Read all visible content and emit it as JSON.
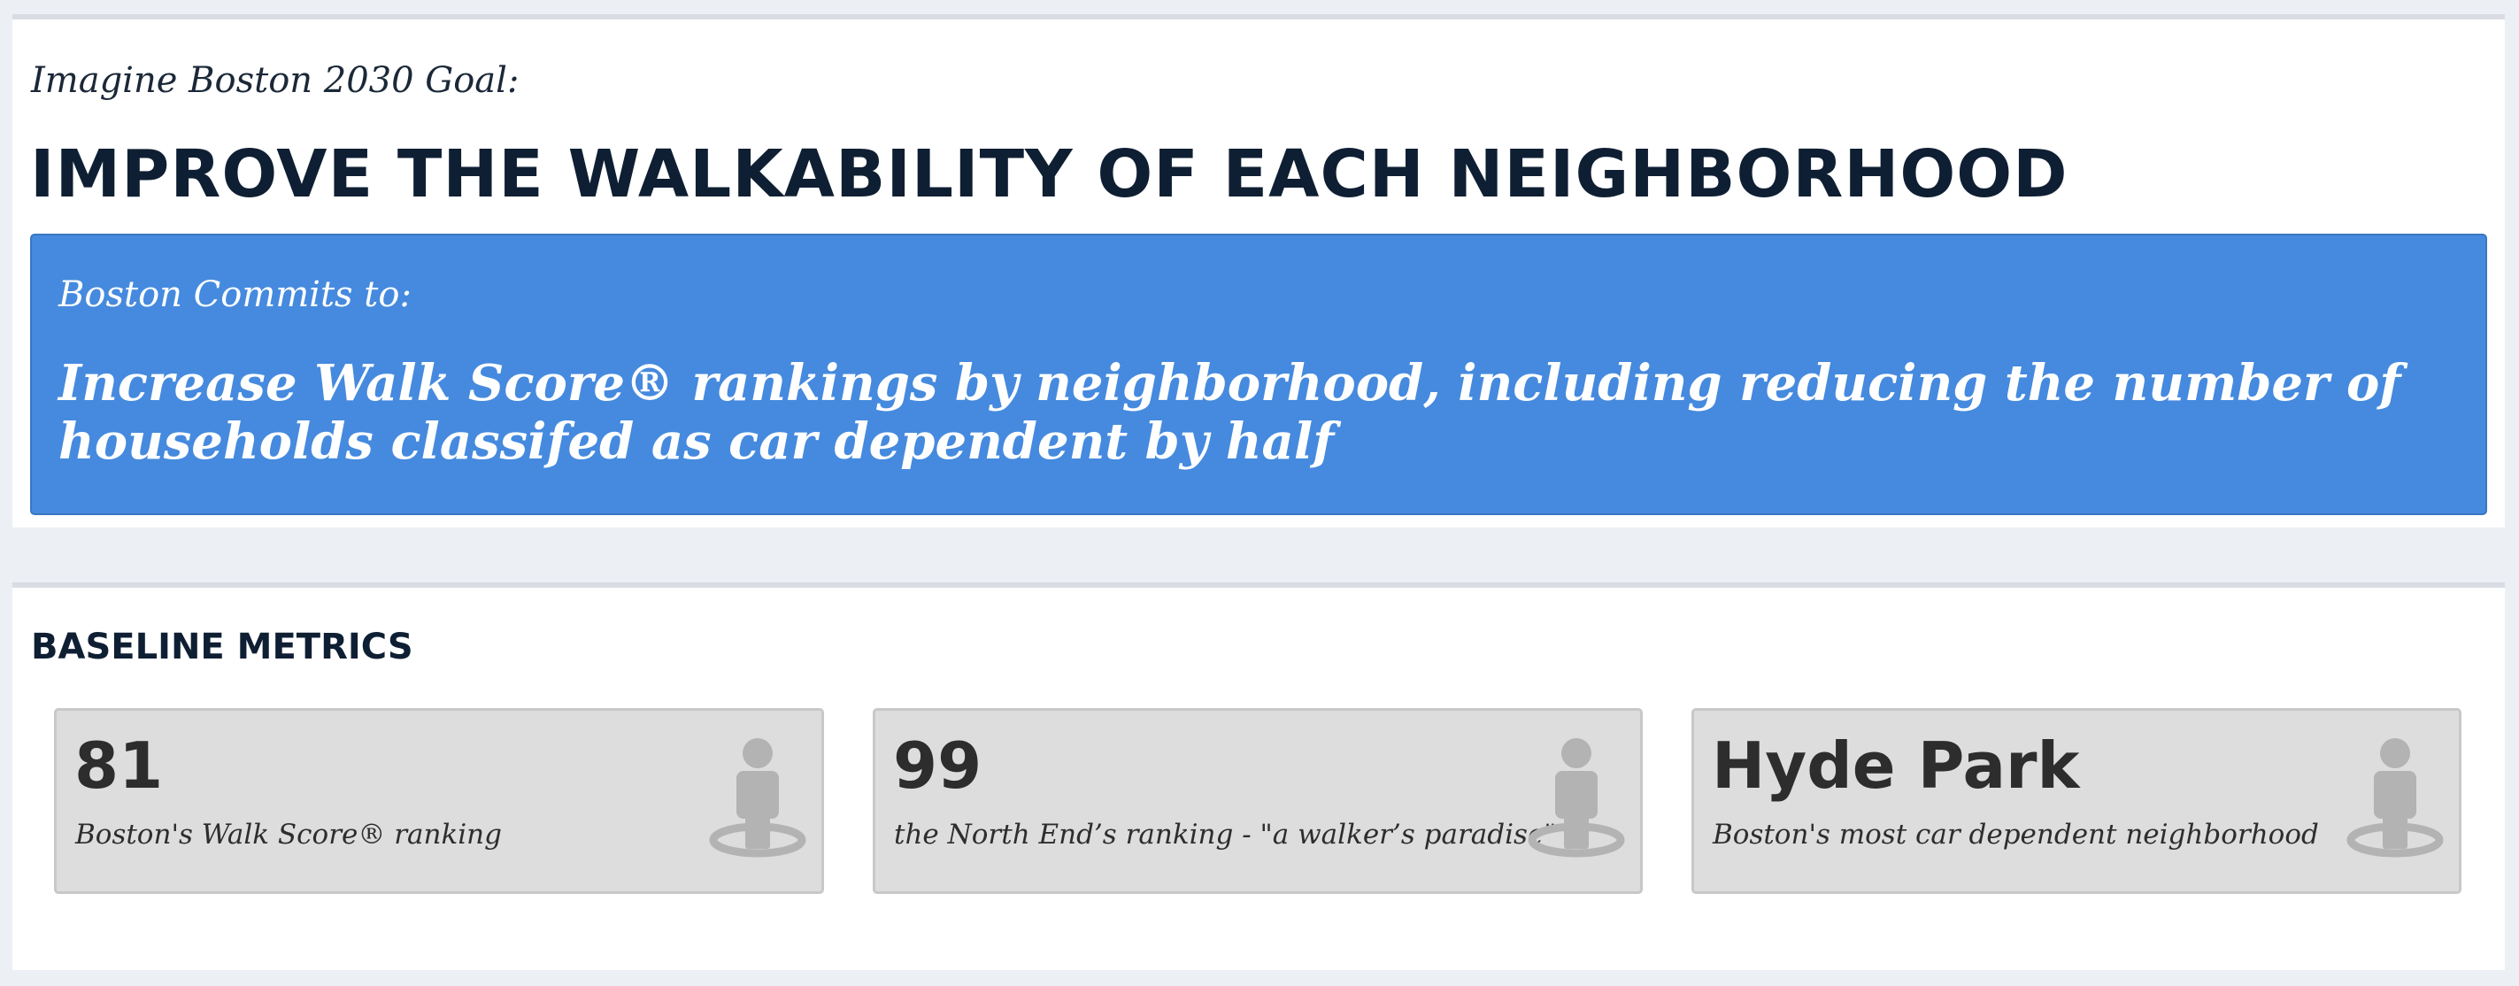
{
  "goal": {
    "label": "Imagine Boston 2030 Goal:",
    "title": "IMPROVE THE WALKABILITY OF EACH NEIGHBORHOOD"
  },
  "commitment": {
    "label": "Boston Commits to:",
    "text": "Increase Walk Score® rankings by neighborhood, including reducing the number of households classifed as car dependent by half",
    "background_color": "#458ade"
  },
  "baseline": {
    "title": "BASELINE METRICS",
    "metrics": [
      {
        "value": "81",
        "description": "Boston's Walk Score® ranking",
        "icon": "walker-icon"
      },
      {
        "value": "99",
        "description": "the North End’s ranking - \"a walker’s paradise\"",
        "icon": "walker-icon"
      },
      {
        "value": "Hyde Park",
        "description": "Boston's most car dependent neighborhood",
        "icon": "walker-icon"
      }
    ]
  },
  "colors": {
    "page_background": "#eceff3",
    "heading_text": "#0f1f33",
    "card_background": "#dddddd",
    "icon_color": "#b3b3b3"
  }
}
